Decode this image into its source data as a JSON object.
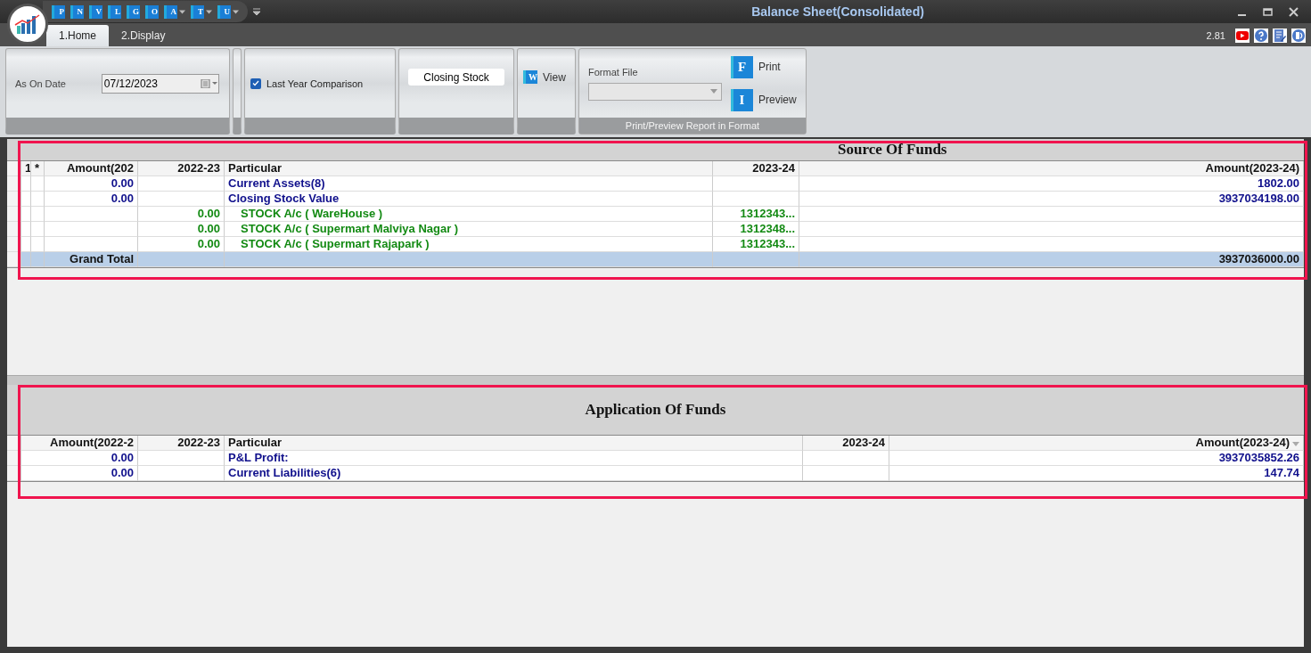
{
  "window": {
    "title": "Balance Sheet(Consolidated)",
    "version": "2.81"
  },
  "quick_access": [
    {
      "letter": "P",
      "dropdown": false
    },
    {
      "letter": "N",
      "dropdown": false
    },
    {
      "letter": "V",
      "dropdown": false
    },
    {
      "letter": "L",
      "dropdown": false
    },
    {
      "letter": "G",
      "dropdown": false
    },
    {
      "letter": "O",
      "dropdown": false
    },
    {
      "letter": "A",
      "dropdown": true
    },
    {
      "letter": "T",
      "dropdown": true
    },
    {
      "letter": "U",
      "dropdown": true
    }
  ],
  "tabs": [
    {
      "label": "1.Home",
      "selected": true
    },
    {
      "label": "2.Display",
      "selected": false
    }
  ],
  "ribbon": {
    "as_on_date": {
      "label": "As On Date",
      "value": "07/12/2023"
    },
    "last_year_comparison": {
      "label": "Last Year Comparison",
      "checked": true
    },
    "closing_stock_button": "Closing Stock",
    "view_button": {
      "icon_letter": "W",
      "label": "View"
    },
    "format_group": {
      "label": "Format File",
      "print": {
        "icon_letter": "F",
        "label": "Print"
      },
      "preview": {
        "icon_letter": "I",
        "label": "Preview"
      },
      "caption": "Print/Preview Report in Format"
    }
  },
  "source_of_funds": {
    "title": "Source Of Funds",
    "columns": [
      "1",
      "*",
      "Amount(202",
      "2022-23",
      "Particular",
      "2023-24",
      "Amount(2023-24)"
    ],
    "rows": [
      {
        "kind": "group",
        "amount_prev": "0.00",
        "particular": "Current Assets(8)",
        "amount_current": "1802.00"
      },
      {
        "kind": "group",
        "amount_prev": "0.00",
        "particular": "Closing Stock Value",
        "amount_current": "3937034198.00"
      },
      {
        "kind": "child",
        "prev_year": "0.00",
        "particular": "STOCK A/c (  WareHouse )",
        "current_year": "1312343..."
      },
      {
        "kind": "child",
        "prev_year": "0.00",
        "particular": "STOCK A/c ( Supermart Malviya Nagar )",
        "current_year": "1312348..."
      },
      {
        "kind": "child",
        "prev_year": "0.00",
        "particular": "STOCK A/c ( Supermart Rajapark )",
        "current_year": "1312343..."
      },
      {
        "kind": "total",
        "amount_prev": "Grand Total",
        "amount_current": "3937036000.00"
      }
    ]
  },
  "application_of_funds": {
    "title": "Application Of Funds",
    "columns": [
      "Amount(2022-2",
      "2022-23",
      "Particular",
      "2023-24",
      "Amount(2023-24)"
    ],
    "rows": [
      {
        "kind": "group",
        "amount_prev": "0.00",
        "particular": "P&L Profit:",
        "amount_current": "3937035852.26"
      },
      {
        "kind": "group",
        "amount_prev": "0.00",
        "particular": "Current Liabilities(6)",
        "amount_current": "147.74"
      }
    ]
  }
}
